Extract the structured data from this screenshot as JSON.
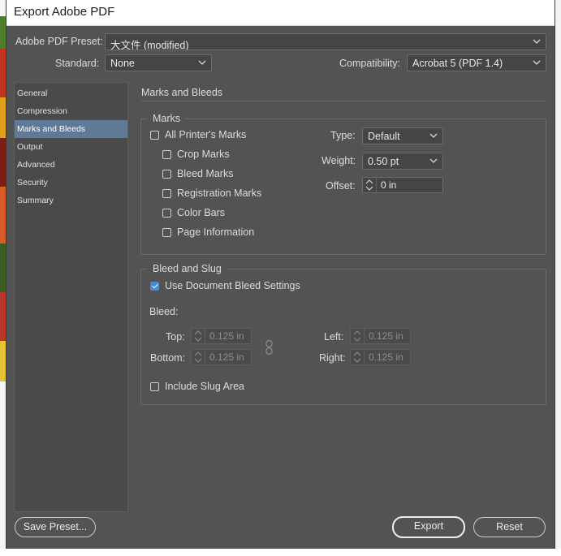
{
  "window": {
    "title": "Export Adobe PDF"
  },
  "header": {
    "preset_label": "Adobe PDF Preset:",
    "preset_value": "大文件 (modified)",
    "standard_label": "Standard:",
    "standard_value": "None",
    "compat_label": "Compatibility:",
    "compat_value": "Acrobat 5 (PDF 1.4)"
  },
  "sidebar": {
    "items": [
      {
        "label": "General",
        "selected": false
      },
      {
        "label": "Compression",
        "selected": false
      },
      {
        "label": "Marks and Bleeds",
        "selected": true
      },
      {
        "label": "Output",
        "selected": false
      },
      {
        "label": "Advanced",
        "selected": false
      },
      {
        "label": "Security",
        "selected": false
      },
      {
        "label": "Summary",
        "selected": false
      }
    ]
  },
  "main": {
    "section_title": "Marks and Bleeds",
    "marks": {
      "group_title": "Marks",
      "all_printers_marks": {
        "label": "All Printer's Marks",
        "checked": false
      },
      "crop_marks": {
        "label": "Crop Marks",
        "checked": false
      },
      "bleed_marks": {
        "label": "Bleed Marks",
        "checked": false
      },
      "registration_marks": {
        "label": "Registration Marks",
        "checked": false
      },
      "color_bars": {
        "label": "Color Bars",
        "checked": false
      },
      "page_information": {
        "label": "Page Information",
        "checked": false
      },
      "type_label": "Type:",
      "type_value": "Default",
      "weight_label": "Weight:",
      "weight_value": "0.50 pt",
      "offset_label": "Offset:",
      "offset_value": "0 in"
    },
    "bleed": {
      "group_title": "Bleed and Slug",
      "use_document": {
        "label": "Use Document Bleed Settings",
        "checked": true
      },
      "bleed_label": "Bleed:",
      "top_label": "Top:",
      "top_value": "0.125 in",
      "bottom_label": "Bottom:",
      "bottom_value": "0.125 in",
      "left_label": "Left:",
      "left_value": "0.125 in",
      "right_label": "Right:",
      "right_value": "0.125 in",
      "include_slug": {
        "label": "Include Slug Area",
        "checked": false
      }
    }
  },
  "footer": {
    "save_preset": "Save Preset...",
    "export": "Export",
    "reset": "Reset"
  },
  "colors": {
    "dialog_bg": "#535353",
    "selection": "#5f7a96",
    "checkbox_checked": "#3d8ee0"
  }
}
